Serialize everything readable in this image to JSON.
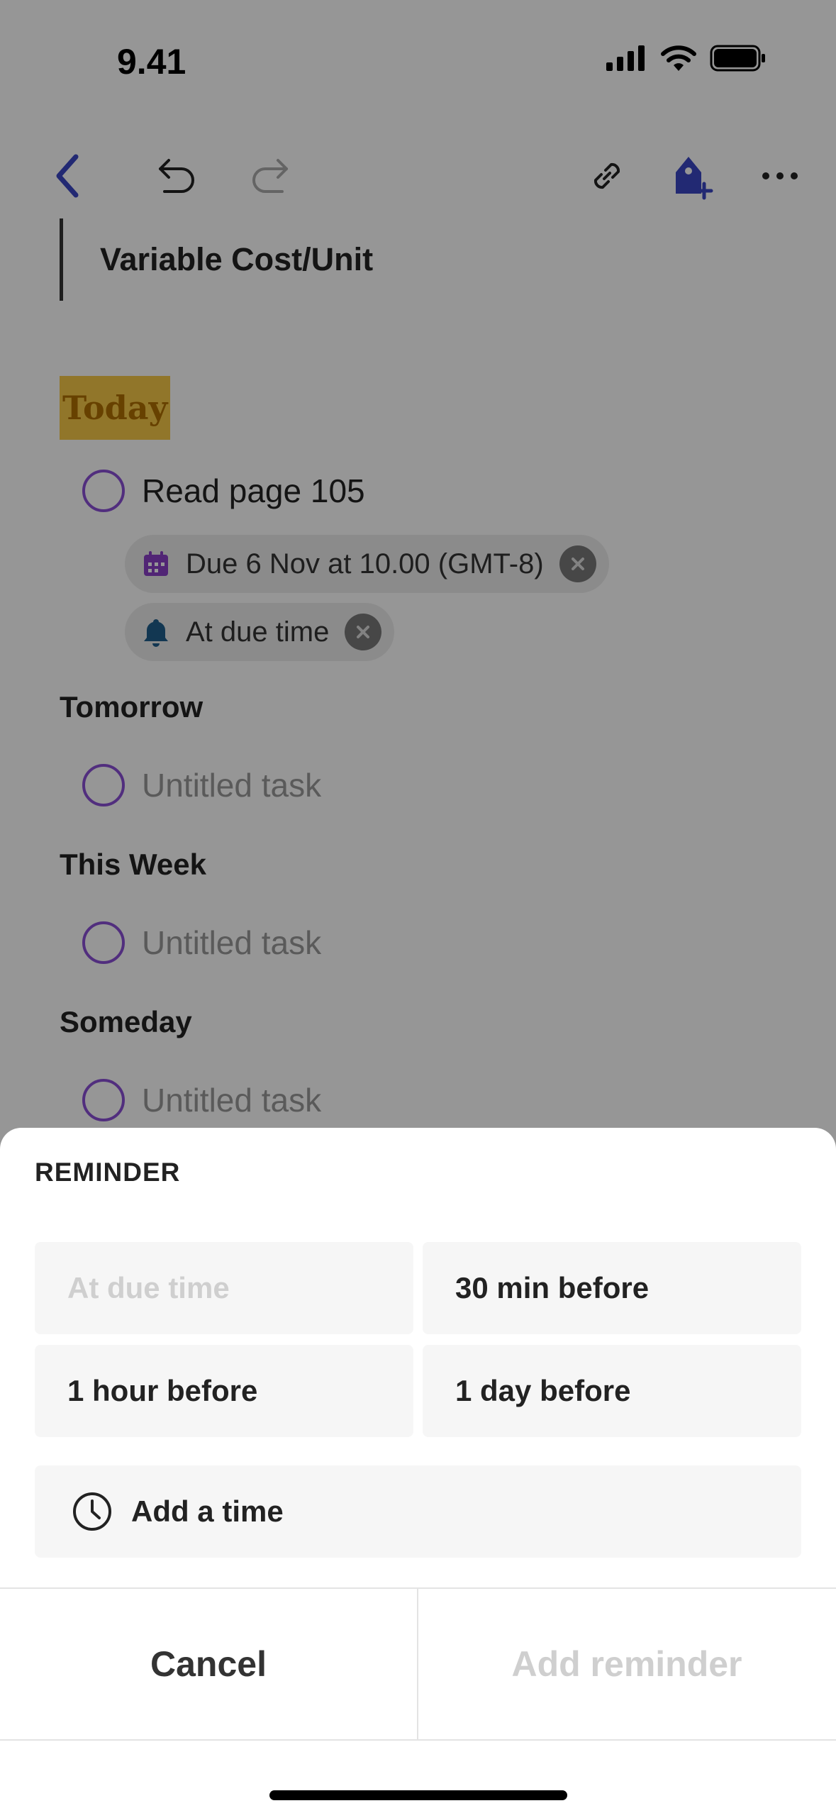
{
  "status_bar": {
    "time": "9.41"
  },
  "toolbar": {
    "icons": [
      "back-chevron-icon",
      "undo-icon",
      "redo-icon",
      "link-icon",
      "add-tag-icon",
      "more-icon"
    ],
    "accent": "#3b46c4"
  },
  "note": {
    "quote": "Variable Cost/Unit",
    "today_heading": "Today",
    "today_task": "Read page 105",
    "due_chip": "Due 6 Nov at 10.00 (GMT-8)",
    "reminder_chip": "At due time",
    "sections": [
      {
        "heading": "Tomorrow",
        "task": "Untitled task"
      },
      {
        "heading": "This Week",
        "task": "Untitled task"
      },
      {
        "heading": "Someday",
        "task": "Untitled task"
      }
    ]
  },
  "sheet": {
    "title": "REMINDER",
    "options": [
      "At due time",
      "30 min before",
      "1 hour before",
      "1 day before"
    ],
    "add_time": "Add a time",
    "cancel": "Cancel",
    "add_reminder": "Add reminder"
  },
  "colors": {
    "task_circle": "#8b4fd6",
    "today_highlight": "#f7c948",
    "today_text": "#b06f00",
    "disabled_text": "#cfcfcf"
  }
}
